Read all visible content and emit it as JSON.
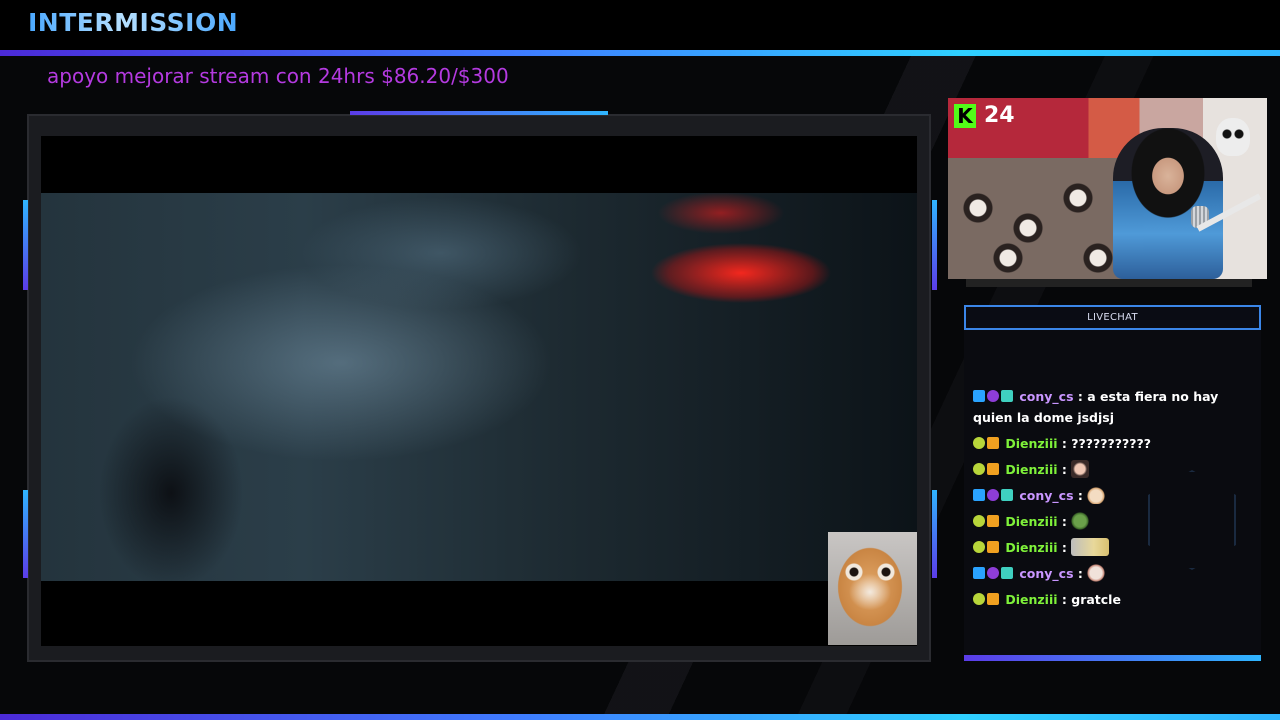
{
  "header": {
    "title": "INTERMISSION",
    "goal_text": "apoyo mejorar stream con 24hrs $86.20/$300"
  },
  "webcam": {
    "viewer_count": "24",
    "platform_icon": "kick-logo-icon"
  },
  "chat": {
    "title": "LIVECHAT",
    "messages": [
      {
        "user": "cony_cs",
        "text": "a esta fiera no hay quien la dome jsdjsj",
        "badges": [
          "arrow-badge",
          "heart-badge",
          "boost-badge"
        ]
      },
      {
        "user": "Dienziii",
        "text": "???????????",
        "badges": [
          "smile-badge",
          "crown-badge"
        ]
      },
      {
        "user": "Dienziii",
        "text": "",
        "emote": "girl-emote",
        "badges": [
          "smile-badge",
          "crown-badge"
        ]
      },
      {
        "user": "cony_cs",
        "text": "",
        "emote": "cat-emote",
        "badges": [
          "arrow-badge",
          "heart-badge",
          "boost-badge"
        ]
      },
      {
        "user": "Dienziii",
        "text": "",
        "emote": "frog-emote",
        "badges": [
          "smile-badge",
          "crown-badge"
        ]
      },
      {
        "user": "Dienziii",
        "text": "",
        "emote": "wide-emote",
        "badges": [
          "smile-badge",
          "crown-badge"
        ]
      },
      {
        "user": "cony_cs",
        "text": "",
        "emote": "cat-emote-2",
        "badges": [
          "arrow-badge",
          "heart-badge",
          "boost-badge"
        ]
      },
      {
        "user": "Dienziii",
        "text": "gratcle",
        "badges": [
          "smile-badge",
          "crown-badge"
        ]
      }
    ],
    "separator": ":"
  },
  "colors": {
    "accent_blue": "#2fb5ff",
    "accent_purple": "#5b3ce8",
    "goal_text": "#b43ae0",
    "user_cony": "#c996ff",
    "user_dienziii": "#7ff23a",
    "kick_green": "#53fc18"
  }
}
